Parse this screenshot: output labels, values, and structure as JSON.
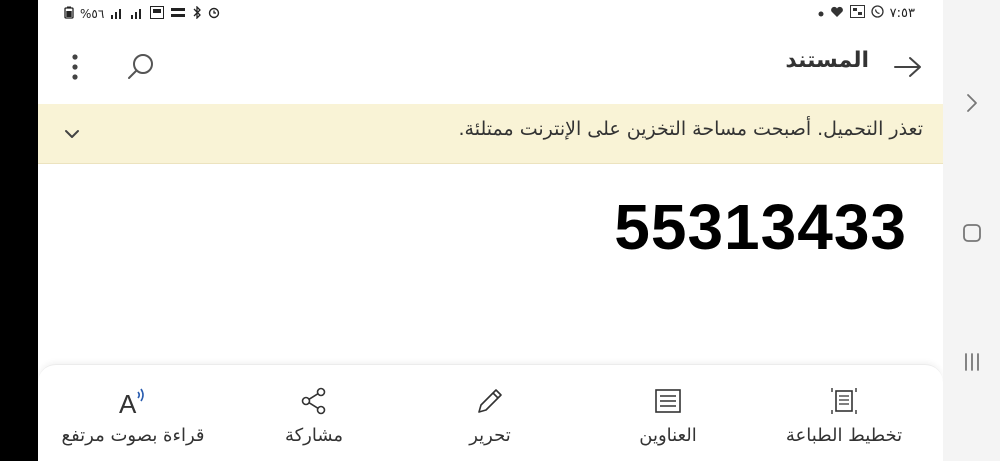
{
  "statusbar": {
    "left_battery_text": "%٥٦",
    "right_time": "٧:٥٣"
  },
  "toolbar": {
    "title": "المستند",
    "back_icon": "arrow-right-icon",
    "search_icon": "search-icon",
    "menu_icon": "more-vert-icon"
  },
  "banner": {
    "message": "تعذر التحميل. أصبحت مساحة التخزين على الإنترنت ممتلئة.",
    "expand_icon": "chevron-down-icon",
    "background": "#f9f3d6"
  },
  "document": {
    "content": "55313433"
  },
  "bottom_actions": [
    {
      "label": "قراءة بصوت مرتفع",
      "icon": "read-aloud-icon"
    },
    {
      "label": "مشاركة",
      "icon": "share-icon"
    },
    {
      "label": "تحرير",
      "icon": "edit-icon"
    },
    {
      "label": "العناوين",
      "icon": "headings-icon"
    },
    {
      "label": "تخطيط الطباعة",
      "icon": "print-layout-icon"
    }
  ],
  "system_nav": {
    "back_icon": "chevron-right-icon",
    "home_icon": "home-icon",
    "recents_icon": "recents-icon"
  }
}
